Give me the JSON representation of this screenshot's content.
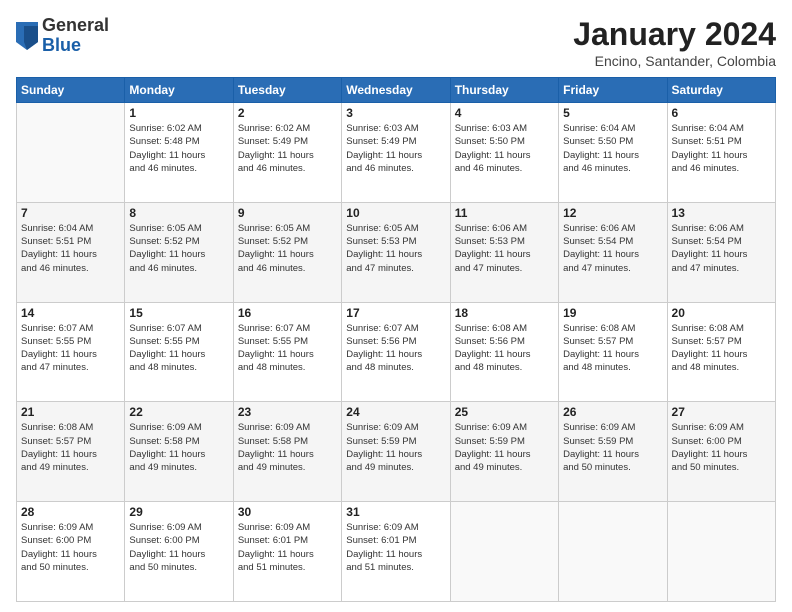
{
  "logo": {
    "general": "General",
    "blue": "Blue"
  },
  "title": "January 2024",
  "subtitle": "Encino, Santander, Colombia",
  "headers": [
    "Sunday",
    "Monday",
    "Tuesday",
    "Wednesday",
    "Thursday",
    "Friday",
    "Saturday"
  ],
  "weeks": [
    [
      {
        "day": "",
        "info": ""
      },
      {
        "day": "1",
        "info": "Sunrise: 6:02 AM\nSunset: 5:48 PM\nDaylight: 11 hours\nand 46 minutes."
      },
      {
        "day": "2",
        "info": "Sunrise: 6:02 AM\nSunset: 5:49 PM\nDaylight: 11 hours\nand 46 minutes."
      },
      {
        "day": "3",
        "info": "Sunrise: 6:03 AM\nSunset: 5:49 PM\nDaylight: 11 hours\nand 46 minutes."
      },
      {
        "day": "4",
        "info": "Sunrise: 6:03 AM\nSunset: 5:50 PM\nDaylight: 11 hours\nand 46 minutes."
      },
      {
        "day": "5",
        "info": "Sunrise: 6:04 AM\nSunset: 5:50 PM\nDaylight: 11 hours\nand 46 minutes."
      },
      {
        "day": "6",
        "info": "Sunrise: 6:04 AM\nSunset: 5:51 PM\nDaylight: 11 hours\nand 46 minutes."
      }
    ],
    [
      {
        "day": "7",
        "info": "Sunrise: 6:04 AM\nSunset: 5:51 PM\nDaylight: 11 hours\nand 46 minutes."
      },
      {
        "day": "8",
        "info": "Sunrise: 6:05 AM\nSunset: 5:52 PM\nDaylight: 11 hours\nand 46 minutes."
      },
      {
        "day": "9",
        "info": "Sunrise: 6:05 AM\nSunset: 5:52 PM\nDaylight: 11 hours\nand 46 minutes."
      },
      {
        "day": "10",
        "info": "Sunrise: 6:05 AM\nSunset: 5:53 PM\nDaylight: 11 hours\nand 47 minutes."
      },
      {
        "day": "11",
        "info": "Sunrise: 6:06 AM\nSunset: 5:53 PM\nDaylight: 11 hours\nand 47 minutes."
      },
      {
        "day": "12",
        "info": "Sunrise: 6:06 AM\nSunset: 5:54 PM\nDaylight: 11 hours\nand 47 minutes."
      },
      {
        "day": "13",
        "info": "Sunrise: 6:06 AM\nSunset: 5:54 PM\nDaylight: 11 hours\nand 47 minutes."
      }
    ],
    [
      {
        "day": "14",
        "info": "Sunrise: 6:07 AM\nSunset: 5:55 PM\nDaylight: 11 hours\nand 47 minutes."
      },
      {
        "day": "15",
        "info": "Sunrise: 6:07 AM\nSunset: 5:55 PM\nDaylight: 11 hours\nand 48 minutes."
      },
      {
        "day": "16",
        "info": "Sunrise: 6:07 AM\nSunset: 5:55 PM\nDaylight: 11 hours\nand 48 minutes."
      },
      {
        "day": "17",
        "info": "Sunrise: 6:07 AM\nSunset: 5:56 PM\nDaylight: 11 hours\nand 48 minutes."
      },
      {
        "day": "18",
        "info": "Sunrise: 6:08 AM\nSunset: 5:56 PM\nDaylight: 11 hours\nand 48 minutes."
      },
      {
        "day": "19",
        "info": "Sunrise: 6:08 AM\nSunset: 5:57 PM\nDaylight: 11 hours\nand 48 minutes."
      },
      {
        "day": "20",
        "info": "Sunrise: 6:08 AM\nSunset: 5:57 PM\nDaylight: 11 hours\nand 48 minutes."
      }
    ],
    [
      {
        "day": "21",
        "info": "Sunrise: 6:08 AM\nSunset: 5:57 PM\nDaylight: 11 hours\nand 49 minutes."
      },
      {
        "day": "22",
        "info": "Sunrise: 6:09 AM\nSunset: 5:58 PM\nDaylight: 11 hours\nand 49 minutes."
      },
      {
        "day": "23",
        "info": "Sunrise: 6:09 AM\nSunset: 5:58 PM\nDaylight: 11 hours\nand 49 minutes."
      },
      {
        "day": "24",
        "info": "Sunrise: 6:09 AM\nSunset: 5:59 PM\nDaylight: 11 hours\nand 49 minutes."
      },
      {
        "day": "25",
        "info": "Sunrise: 6:09 AM\nSunset: 5:59 PM\nDaylight: 11 hours\nand 49 minutes."
      },
      {
        "day": "26",
        "info": "Sunrise: 6:09 AM\nSunset: 5:59 PM\nDaylight: 11 hours\nand 50 minutes."
      },
      {
        "day": "27",
        "info": "Sunrise: 6:09 AM\nSunset: 6:00 PM\nDaylight: 11 hours\nand 50 minutes."
      }
    ],
    [
      {
        "day": "28",
        "info": "Sunrise: 6:09 AM\nSunset: 6:00 PM\nDaylight: 11 hours\nand 50 minutes."
      },
      {
        "day": "29",
        "info": "Sunrise: 6:09 AM\nSunset: 6:00 PM\nDaylight: 11 hours\nand 50 minutes."
      },
      {
        "day": "30",
        "info": "Sunrise: 6:09 AM\nSunset: 6:01 PM\nDaylight: 11 hours\nand 51 minutes."
      },
      {
        "day": "31",
        "info": "Sunrise: 6:09 AM\nSunset: 6:01 PM\nDaylight: 11 hours\nand 51 minutes."
      },
      {
        "day": "",
        "info": ""
      },
      {
        "day": "",
        "info": ""
      },
      {
        "day": "",
        "info": ""
      }
    ]
  ]
}
